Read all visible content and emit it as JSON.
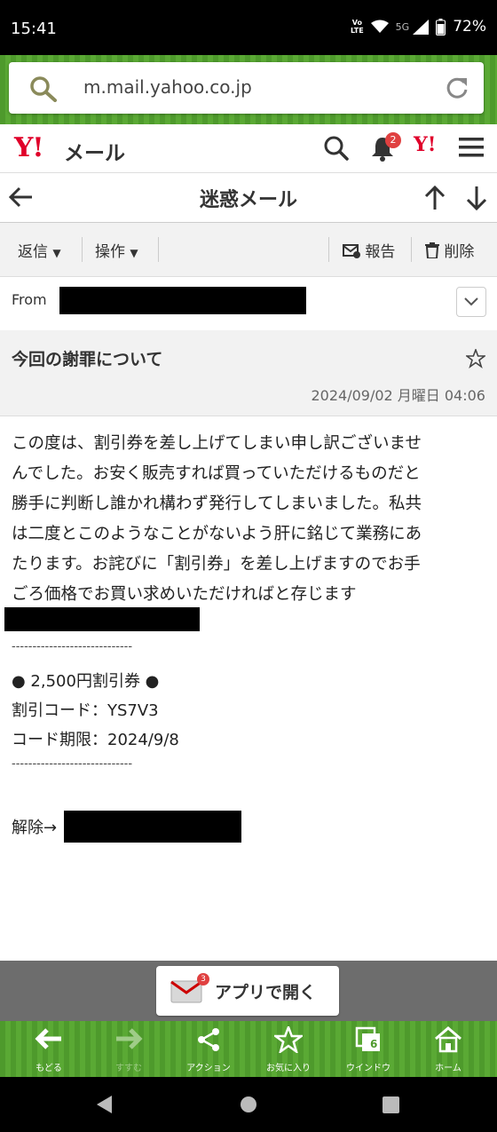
{
  "status_bar": {
    "time": "15:41",
    "volte": "Vo)) LTE",
    "network": "5G",
    "battery": "72%"
  },
  "browser": {
    "url": "m.mail.yahoo.co.jp"
  },
  "header": {
    "logo": "Y!",
    "service": "メール",
    "notification_count": "2",
    "yahoo_small": "Y!"
  },
  "folder": {
    "title": "迷惑メール"
  },
  "toolbar": {
    "reply": "返信",
    "operate": "操作",
    "report": "報告",
    "delete": "削除"
  },
  "message": {
    "from_label": "From",
    "subject": "今回の謝罪について",
    "date": "2024/09/02 月曜日 04:06",
    "body_lines": [
      "この度は、割引券を差し上げてしまい申し訳ございませ",
      "んでした。お安く販売すれば買っていただけるものだと",
      "勝手に判断し誰かれ構わず発行してしまいました。私共",
      "は二度とこのようなことがないよう肝に銘じて業務にあ",
      "たります。お詫びに「割引券」を差し上げますのでお手",
      "ごろ価格でお買い求めいただければと存じます"
    ],
    "divider": "-----------------------------",
    "coupon_title": "● 2,500円割引券 ●",
    "coupon_code": "割引コード：YS7V3",
    "coupon_expiry": "コード期限：2024/9/8",
    "unsubscribe": "解除→"
  },
  "open_app": {
    "label": "アプリで開く",
    "badge": "3"
  },
  "browser_nav": {
    "back": "もどる",
    "forward": "すすむ",
    "action": "アクション",
    "favorite": "お気に入り",
    "window": "ウインドウ",
    "window_count": "6",
    "home": "ホーム"
  }
}
